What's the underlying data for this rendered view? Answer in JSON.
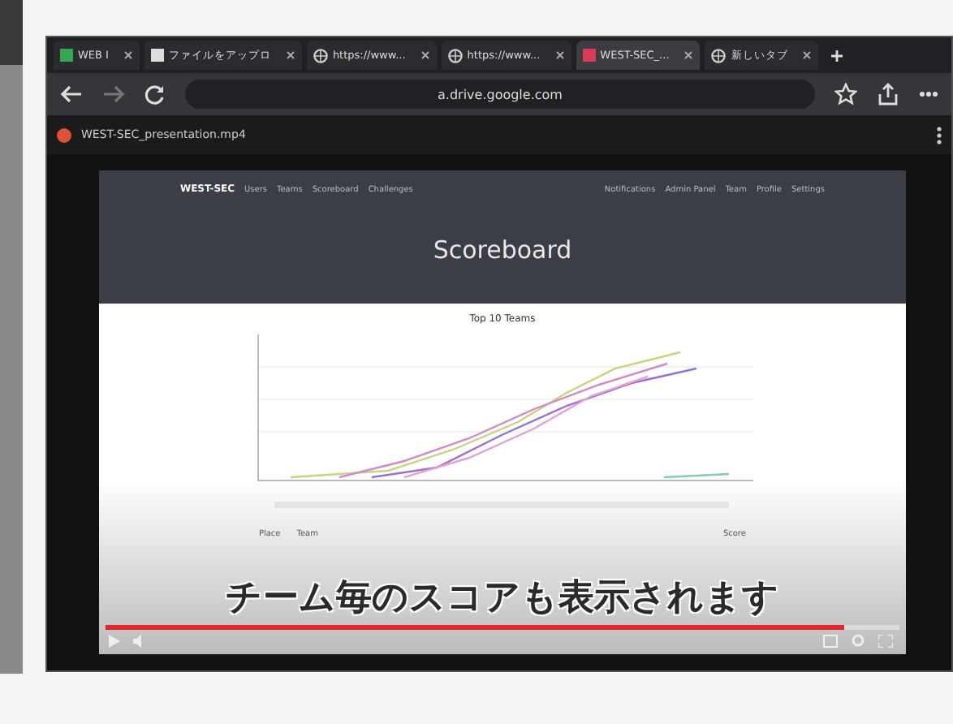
{
  "browser": {
    "tabs": [
      {
        "title": "WEB I",
        "kind": "square",
        "color": "#34a853",
        "selected": false
      },
      {
        "title": "ファイルをアップロ",
        "kind": "square",
        "color": "#dddddd",
        "selected": false
      },
      {
        "title": "https://www...",
        "kind": "globe",
        "selected": false
      },
      {
        "title": "https://www...",
        "kind": "globe",
        "selected": false
      },
      {
        "title": "WEST-SEC_...",
        "kind": "square",
        "color": "#d93a5a",
        "selected": true
      },
      {
        "title": "新しいタブ",
        "kind": "globe",
        "selected": false
      }
    ],
    "url": "a.drive.google.com"
  },
  "drive": {
    "file_title": "WEST-SEC_presentation.mp4"
  },
  "video": {
    "brand": "WEST-SEC",
    "nav": [
      "Users",
      "Teams",
      "Scoreboard",
      "Challenges"
    ],
    "user_nav": [
      "Notifications",
      "Admin Panel",
      "Team",
      "Profile",
      "Settings"
    ],
    "heading": "Scoreboard",
    "chart_title": "Top 10 Teams",
    "table_columns": [
      "Place",
      "Team",
      "Score"
    ],
    "subtitle": "チーム毎のスコアも表示されます",
    "progress": {
      "level": 0.93
    }
  }
}
